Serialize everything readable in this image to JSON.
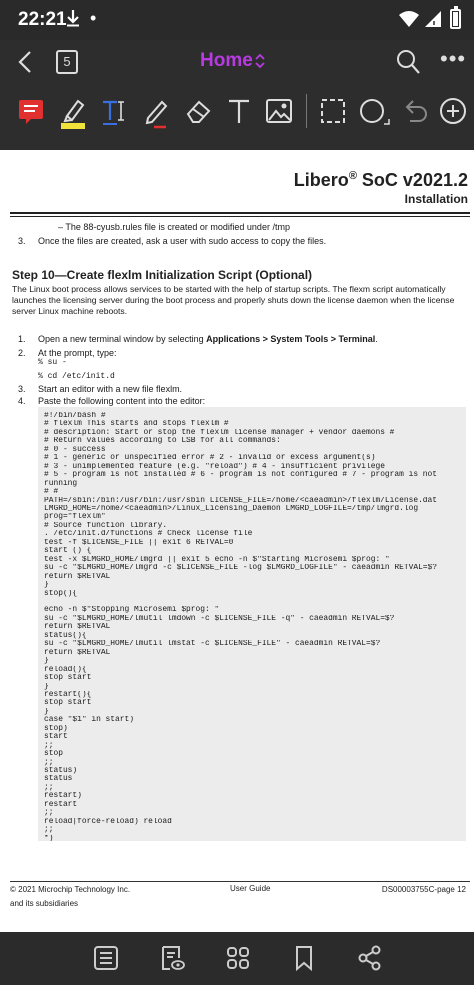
{
  "status_bar": {
    "time": "22:21",
    "download_icon": "download-arrow-icon",
    "dot": "•"
  },
  "app_bar": {
    "page_count": "5",
    "title": "Home",
    "more": "•••"
  },
  "toolbar": {
    "tools": [
      "note-icon",
      "highlighter-icon",
      "text-highlight-icon",
      "pen-icon",
      "eraser-icon",
      "text-icon",
      "image-icon",
      "selection-icon",
      "shape-icon",
      "undo-icon",
      "add-icon"
    ],
    "colors": {
      "note": "#e0302f",
      "highlight": "#f0e23a",
      "text_highlight": "#3a6fe0",
      "pen_underline": "#e0302f"
    }
  },
  "document": {
    "title": "Libero",
    "title_mark": "®",
    "title_rest": " SoC v2021.2",
    "subtitle": "Installation",
    "prev_bullet": "–  The 88-cyusb.rules file is created or modified under /tmp",
    "prev_item_num": "3.",
    "prev_item_text": "Once the files are created, ask a user with sudo access to copy the files.",
    "step_heading": "Step 10—Create flexlm Initialization Script (Optional)",
    "step_para": "The Linux boot process allows services to be started with the help of startup scripts. The flexm script automatically launches the licensing server during the boot process and properly shuts down the license daemon when the license server Linux machine reboots.",
    "items": [
      {
        "num": "1.",
        "pre": "Open a new terminal window by selecting ",
        "bold": "Applications > System Tools > Terminal",
        "post": "."
      },
      {
        "num": "2.",
        "pre": "At the prompt, type:",
        "bold": "",
        "post": ""
      },
      {
        "num": "3.",
        "pre": "Start an editor with a new file flexlm.",
        "bold": "",
        "post": ""
      },
      {
        "num": "4.",
        "pre": "Paste the following content into the editor:",
        "bold": "",
        "post": ""
      }
    ],
    "prompt_cmd1": "% su -",
    "prompt_cmd2": "% cd /etc/init.d",
    "code_lines": [
      "#!/bin/bash #",
      "# flexlm This starts and stops flexlm #",
      "# description: Start or stop the flexlm license manager + vendor daemons #",
      "# Return values according to LSB for all commands:",
      "# 0 - success",
      "# 1 - generic or unspecified error # 2 - invalid or excess argument(s)",
      "# 3 - unimplemented feature (e.g. \"reload\") # 4 - insufficient privilege",
      "# 5 - program is not installed # 6 - program is not configured # 7 - program is not",
      "running",
      "# #",
      "PATH=/sbin:/bin:/usr/bin:/usr/sbin LICENSE_FILE=/home/<caeadmin>/flexlm/License.dat",
      "LMGRD_HOME=/home/<caeadmin>/Linux_Licensing_Daemon LMGRD_LOGFILE=/tmp/lmgrd.log",
      "prog=\"flexlm\"",
      "# Source function library.",
      ". /etc/init.d/functions # Check license file",
      "test -f $LICENSE_FILE || exit 6 RETVAL=0",
      "start () {",
      "test -x $LMGRD_HOME/lmgrd || exit 5 echo -n $\"Starting Microsemi $prog: \"",
      "su -c \"$LMGRD_HOME/lmgrd -c $LICENSE_FILE -log $LMGRD_LOGFILE\" - caeadmin RETVAL=$?",
      "return $RETVAL",
      "}",
      "stop(){",
      "",
      "echo -n $\"Stopping Microsemi $prog: \"",
      "su -c \"$LMGRD_HOME/lmutil lmdown -c $LICENSE_FILE -q\" - caeadmin RETVAL=$?",
      "return $RETVAL",
      "status(){",
      "su -c \"$LMGRD_HOME/lmutil lmstat -c $LICENSE_FILE\" - caeadmin RETVAL=$?",
      "return $RETVAL",
      "}",
      "reload(){",
      "stop start",
      "}",
      "restart(){",
      "stop start",
      "}",
      "case \"$1\" in start)",
      "stop)",
      "start",
      ";;",
      "stop",
      ";;",
      "status)",
      "status",
      ";;",
      "restart)",
      "restart",
      ";;",
      "reload|force-reload) reload",
      ";;",
      "*)",
      "esac"
    ],
    "footer_left_1": "© 2021 Microchip Technology Inc.",
    "footer_left_2": "and its subsidiaries",
    "footer_center": "User Guide",
    "footer_right": "DS00003755C-page 12"
  },
  "bottom_bar": {
    "icons": [
      "list-icon",
      "reading-mode-icon",
      "grid-icon",
      "bookmark-icon",
      "share-icon"
    ]
  }
}
